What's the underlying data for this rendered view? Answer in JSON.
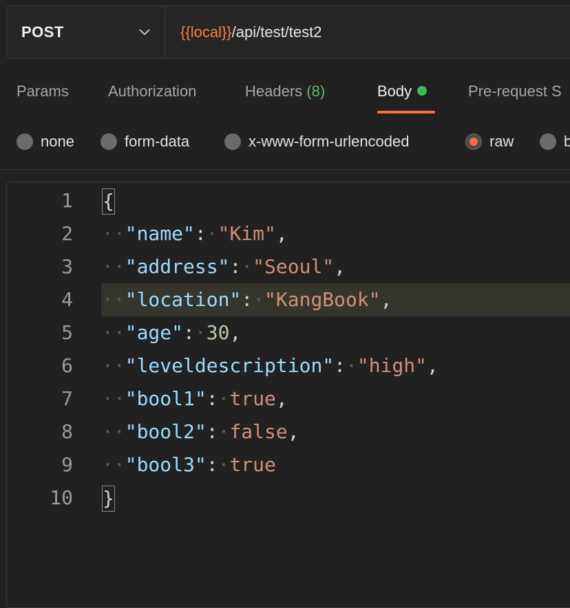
{
  "request": {
    "method": "POST",
    "url_variable": "{{local}}",
    "url_path": "/api/test/test2"
  },
  "tabs": [
    {
      "label": "Params"
    },
    {
      "label": "Authorization"
    },
    {
      "label": "Headers",
      "count": "(8)"
    },
    {
      "label": "Body"
    },
    {
      "label": "Pre-request S"
    }
  ],
  "body_types": [
    {
      "label": "none"
    },
    {
      "label": "form-data"
    },
    {
      "label": "x-www-form-urlencoded"
    },
    {
      "label": "raw"
    },
    {
      "label": "b"
    }
  ],
  "editor": {
    "line_numbers": [
      "1",
      "2",
      "3",
      "4",
      "5",
      "6",
      "7",
      "8",
      "9",
      "10"
    ],
    "lines": [
      {
        "open": "{"
      },
      {
        "key": "\"name\"",
        "colon": ":",
        "value": "\"Kim\"",
        "comma": ","
      },
      {
        "key": "\"address\"",
        "colon": ":",
        "value": "\"Seoul\"",
        "comma": ","
      },
      {
        "key": "\"location\"",
        "colon": ":",
        "value": "\"KangBook\"",
        "comma": ","
      },
      {
        "key": "\"age\"",
        "colon": ":",
        "value": "30",
        "comma": ","
      },
      {
        "key": "\"leveldescription\"",
        "colon": ":",
        "value": "\"high\"",
        "comma": ","
      },
      {
        "key": "\"bool1\"",
        "colon": ":",
        "value": "true",
        "comma": ","
      },
      {
        "key": "\"bool2\"",
        "colon": ":",
        "value": "false",
        "comma": ","
      },
      {
        "key": "\"bool3\"",
        "colon": ":",
        "value": "true",
        "comma": ""
      },
      {
        "close": "}"
      }
    ]
  },
  "colors": {
    "accent": "#ff6c37",
    "url_variable": "#ff7a45",
    "body_dot": "#3fb950",
    "headers_count": "#5fbf6f"
  }
}
